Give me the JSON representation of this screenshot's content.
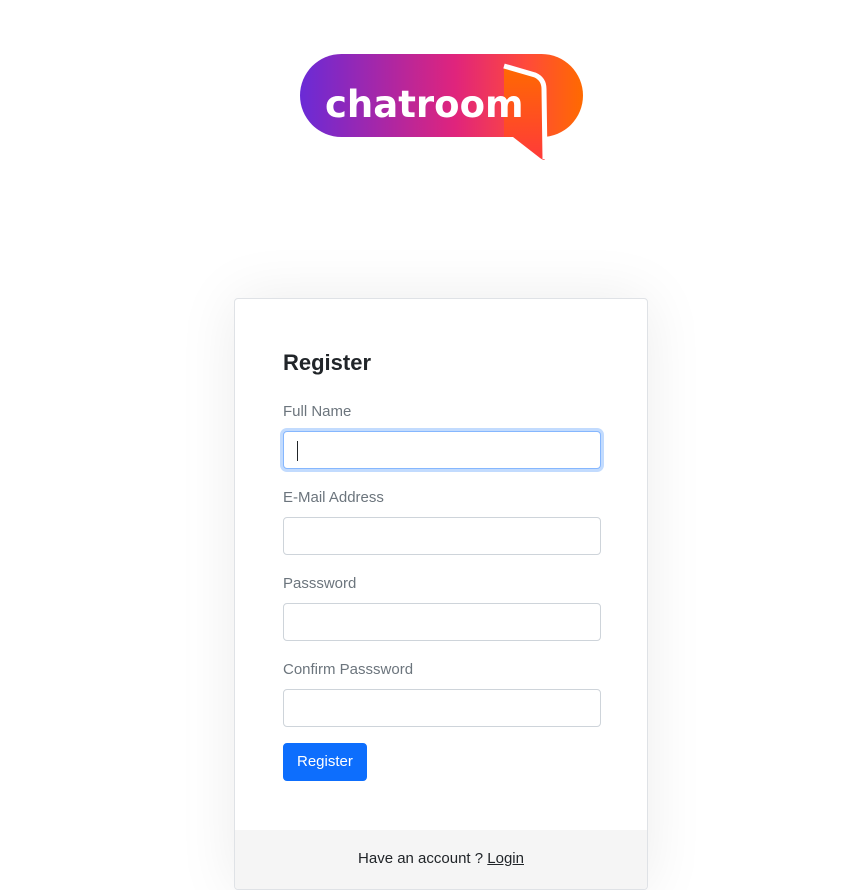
{
  "brand": {
    "logo_text": "chatroom",
    "gradient_colors": [
      "#6a2ad6",
      "#e0247c",
      "#ff6a00"
    ]
  },
  "register_form": {
    "title": "Register",
    "fields": [
      {
        "label": "Full Name",
        "value": "",
        "focused": true
      },
      {
        "label": "E-Mail Address",
        "value": "",
        "focused": false
      },
      {
        "label": "Passsword",
        "value": "",
        "focused": false
      },
      {
        "label": "Confirm Passsword",
        "value": "",
        "focused": false
      }
    ],
    "submit_label": "Register",
    "primary_color": "#0d6efd"
  },
  "footer": {
    "prompt": "Have an account ?",
    "login_link": "Login"
  }
}
